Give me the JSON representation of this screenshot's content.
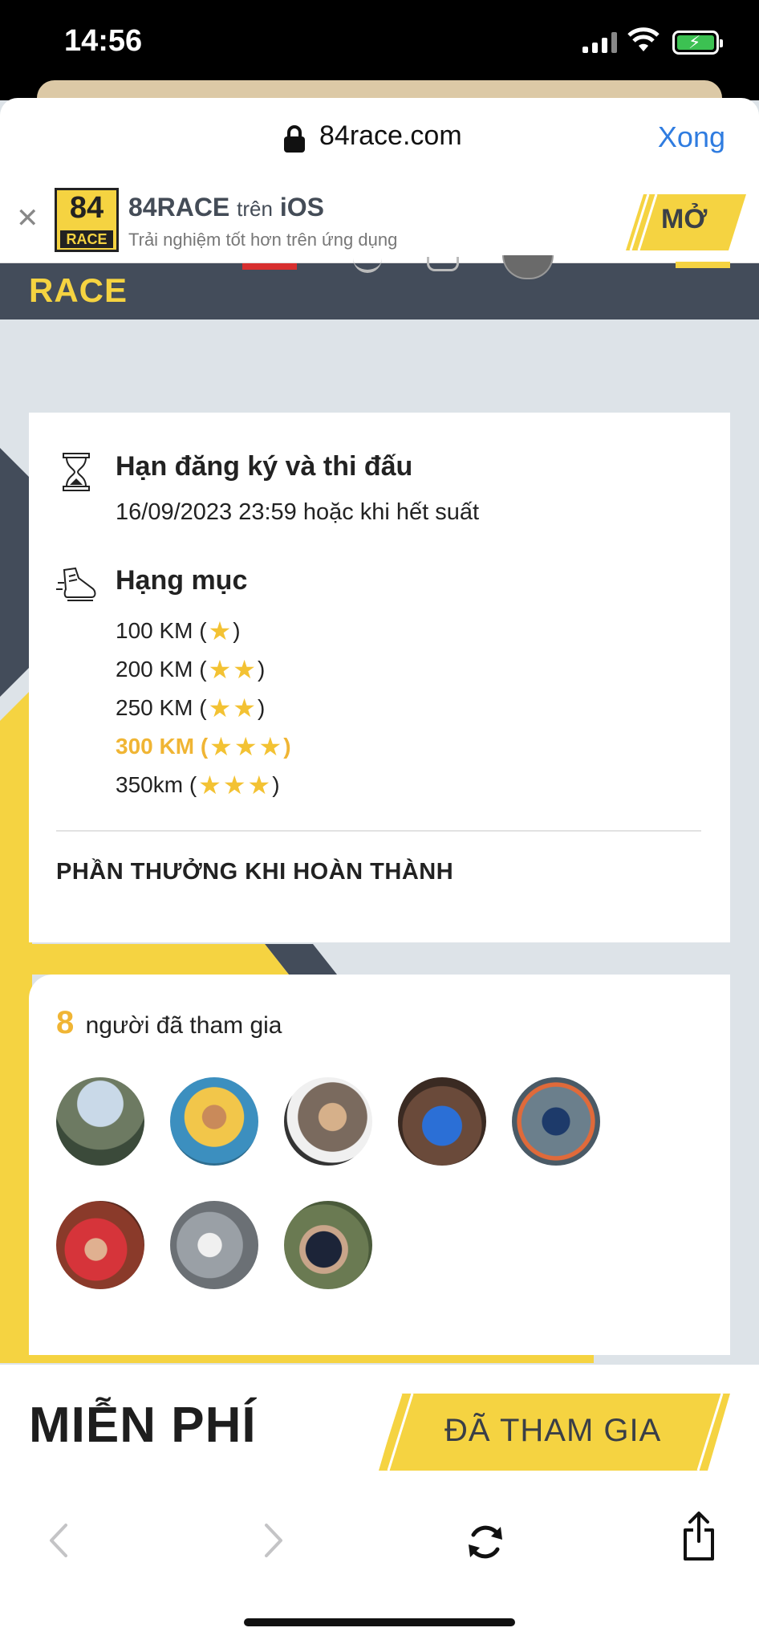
{
  "status_bar": {
    "time": "14:56"
  },
  "browser": {
    "url": "84race.com",
    "done_label": "Xong"
  },
  "app_banner": {
    "logo_number": "84",
    "logo_text": "RACE",
    "app_name": "84RACE",
    "on_label": "trên",
    "platform": "iOS",
    "subtitle": "Trải nghiệm tốt hơn trên ứng dụng",
    "open_label": "MỞ"
  },
  "site_header": {
    "logo_text": "RACE"
  },
  "registration": {
    "title": "Hạn đăng ký và thi đấu",
    "deadline": "16/09/2023 23:59 hoặc khi hết suất"
  },
  "categories": {
    "title": "Hạng mục",
    "items": [
      {
        "label": "100 KM",
        "stars": 1,
        "active": false
      },
      {
        "label": "200 KM",
        "stars": 2,
        "active": false
      },
      {
        "label": "250 KM",
        "stars": 2,
        "active": false
      },
      {
        "label": "300 KM",
        "stars": 3,
        "active": true
      },
      {
        "label": "350km",
        "stars": 3,
        "active": false
      }
    ]
  },
  "reward": {
    "title": "PHẦN THƯỞNG KHI HOÀN THÀNH"
  },
  "participants": {
    "count": "8",
    "label": "người đã tham gia",
    "avatars": [
      "avatar-1",
      "avatar-2",
      "avatar-3",
      "avatar-4",
      "avatar-5",
      "avatar-6",
      "avatar-7",
      "avatar-8"
    ]
  },
  "footer": {
    "price": "MIỄN PHÍ",
    "join_label": "ĐÃ THAM GIA"
  },
  "colors": {
    "accent": "#f5d341",
    "header": "#434c5a",
    "link": "#2f7ce0",
    "star": "#f3c233"
  }
}
